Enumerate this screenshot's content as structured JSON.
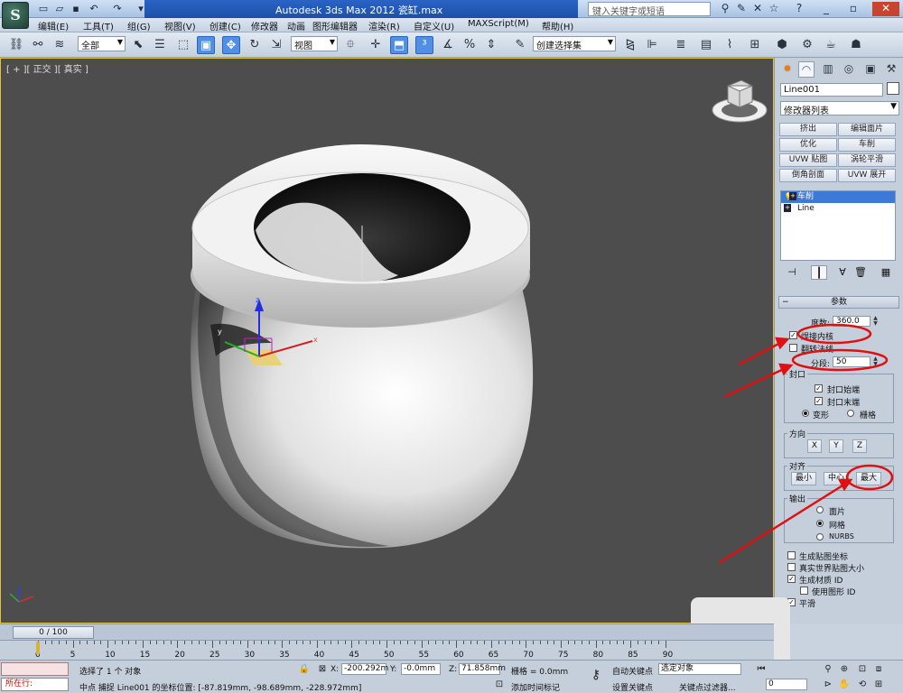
{
  "titlebar": {
    "title": "Autodesk 3ds Max  2012",
    "filename": "瓷缸.max",
    "search_placeholder": "键入关键字或短语",
    "logo": "S"
  },
  "menu": [
    "编辑(E)",
    "工具(T)",
    "组(G)",
    "视图(V)",
    "创建(C)",
    "修改器",
    "动画",
    "图形编辑器",
    "渲染(R)",
    "自定义(U)",
    "MAXScript(M)",
    "帮助(H)"
  ],
  "toolbar": {
    "filter": "全部",
    "ref_coord": "视图",
    "named_selection": "创建选择集"
  },
  "viewport": {
    "label": "[ + ][ 正交 ][ 真实 ]",
    "axis_x": "x",
    "axis_y": "y",
    "axis_z": "z"
  },
  "cmdpanel": {
    "object_name": "Line001",
    "modifier_list": "修改器列表",
    "quick_buttons": [
      "挤出",
      "编辑面片",
      "优化",
      "车削",
      "UVW 贴图",
      "涡轮平滑",
      "倒角剖面",
      "UVW 展开"
    ],
    "stack": [
      {
        "label": "车削",
        "selected": true
      },
      {
        "label": "Line",
        "selected": false
      }
    ],
    "params": {
      "title": "参数",
      "degrees_label": "度数:",
      "degrees_value": "360.0",
      "weld_core": "焊接内核",
      "weld_core_checked": true,
      "flip_normals": "翻转法线",
      "flip_normals_checked": false,
      "segments_label": "分段:",
      "segments_value": "50",
      "capping_title": "封口",
      "cap_start": "封口始端",
      "cap_end": "封口末端",
      "morph": "变形",
      "grid": "栅格",
      "direction_title": "方向",
      "dir_x": "X",
      "dir_y": "Y",
      "dir_z": "Z",
      "align_title": "对齐",
      "align_min": "最小",
      "align_center": "中心",
      "align_max": "最大",
      "output_title": "输出",
      "out_patch": "面片",
      "out_mesh": "网格",
      "out_nurbs": "NURBS",
      "gen_map_coords": "生成贴图坐标",
      "real_world": "真实世界贴图大小",
      "gen_mat_ids": "生成材质 ID",
      "use_shape_ids": "使用图形 ID",
      "smooth": "平滑"
    }
  },
  "timeslider": {
    "frame": "0 / 100"
  },
  "trackbar": {
    "ticks": [
      "0",
      "5",
      "10",
      "15",
      "20",
      "25",
      "30",
      "35",
      "40",
      "45",
      "50",
      "55",
      "60",
      "65",
      "70",
      "75",
      "80",
      "85",
      "90"
    ]
  },
  "status": {
    "selected": "选择了 1 个 对象",
    "prompt": "中点 捕捉 Line001 的坐标位置: [-87.819mm, -98.689mm, -228.972mm]",
    "x_label": "X:",
    "x_value": "-200.292m",
    "y_label": "Y:",
    "y_value": "-0.0mm",
    "z_label": "Z:",
    "z_value": "71.858mm",
    "grid": "栅格 = 0.0mm",
    "auto_key": "自动关键点",
    "set_key": "设置关键点",
    "selected_obj": "选定对象",
    "key_filters": "关键点过滤器...",
    "add_time_tag": "添加时间标记",
    "frame_field": "0",
    "listener": "所在行:"
  },
  "colors": {
    "viewport_bg": "#4d4d4d",
    "annotation": "#e01010",
    "highlight": "#3d7ad8"
  }
}
